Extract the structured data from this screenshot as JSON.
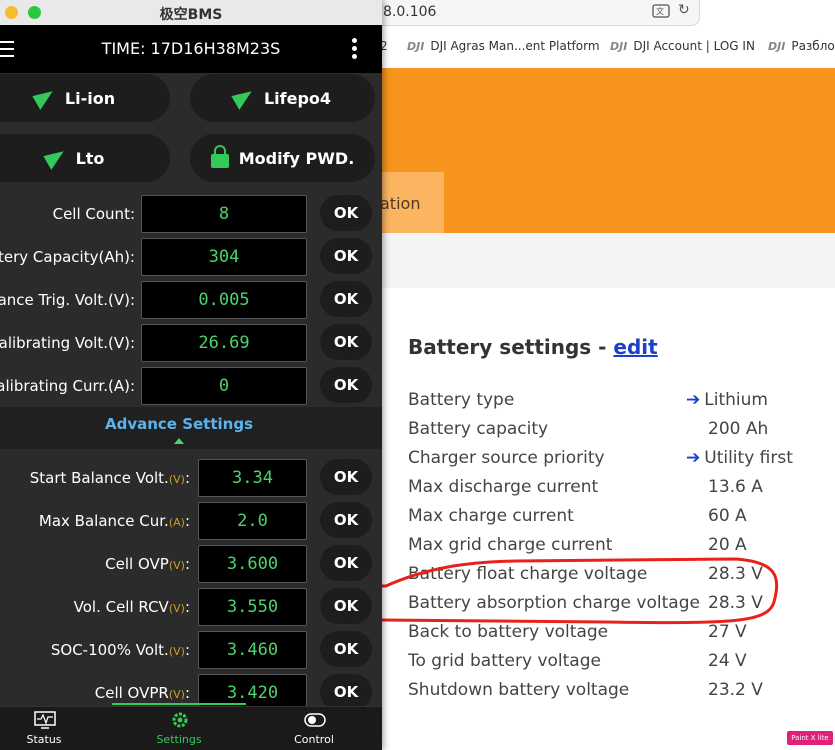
{
  "browser": {
    "address_text": "8.0.106",
    "bookmarks": [
      {
        "label": "2"
      },
      {
        "label": "DJI Agras Man...ent Platform",
        "logo": "DJI"
      },
      {
        "label": "DJI Account | LOG IN",
        "logo": "DJI"
      },
      {
        "label": "Разбло",
        "logo": "DJI"
      }
    ],
    "tab_fragment": "ation",
    "settings_title": "Battery settings - ",
    "settings_edit_link": "edit",
    "rows": [
      {
        "label": "Battery type",
        "value": "Lithium",
        "arrow": true
      },
      {
        "label": "Battery capacity",
        "value": "200 Ah",
        "arrow": false
      },
      {
        "label": "Charger source priority",
        "value": "Utility first",
        "arrow": true
      },
      {
        "label": "Max discharge current",
        "value": "13.6 A",
        "arrow": false
      },
      {
        "label": "Max charge current",
        "value": "60 A",
        "arrow": false
      },
      {
        "label": "Max grid charge current",
        "value": "20 A",
        "arrow": false
      },
      {
        "label": "Battery float charge voltage",
        "value": "28.3 V",
        "arrow": false
      },
      {
        "label": "Battery absorption charge voltage",
        "value": "28.3 V",
        "arrow": false
      },
      {
        "label": "Back to battery voltage",
        "value": "27 V",
        "arrow": false
      },
      {
        "label": "To grid battery voltage",
        "value": "24 V",
        "arrow": false
      },
      {
        "label": "Shutdown battery voltage",
        "value": "23.2 V",
        "arrow": false
      }
    ],
    "arrow_glyph": "➔",
    "paint_badge": "Paint X lite",
    "annotation_color": "#e8221a"
  },
  "bms": {
    "window_title": "极空BMS",
    "time": "TIME: 17D16H38M23S",
    "buttons": {
      "li_ion": "Li-ion",
      "lifepo4": "Lifepo4",
      "lto": "Lto",
      "modify_pwd": "Modify PWD."
    },
    "fields": [
      {
        "label": "Cell Count:",
        "value": "8"
      },
      {
        "label": "ttery Capacity(Ah):",
        "value": "304"
      },
      {
        "label": "alance Trig. Volt.(V):",
        "value": "0.005"
      },
      {
        "label": "Calibrating Volt.(V):",
        "value": "26.69"
      },
      {
        "label": "Calibrating Curr.(A):",
        "value": "0"
      }
    ],
    "ok_label": "OK",
    "advance_title": "Advance Settings",
    "advanced_fields": [
      {
        "label": "Start Balance Volt.",
        "unit": "(V)",
        "value": "3.34"
      },
      {
        "label": "Max Balance Cur.",
        "unit": "(A)",
        "value": "2.0"
      },
      {
        "label": "Cell OVP",
        "unit": "(V)",
        "value": "3.600"
      },
      {
        "label": "Vol. Cell RCV",
        "unit": "(V)",
        "value": "3.550"
      },
      {
        "label": "SOC-100% Volt.",
        "unit": "(V)",
        "value": "3.460"
      },
      {
        "label": "Cell OVPR",
        "unit": "(V)",
        "value": "3.420"
      }
    ],
    "nav": {
      "status": "Status",
      "settings": "Settings",
      "control": "Control"
    },
    "accent_color": "#35c85a"
  }
}
